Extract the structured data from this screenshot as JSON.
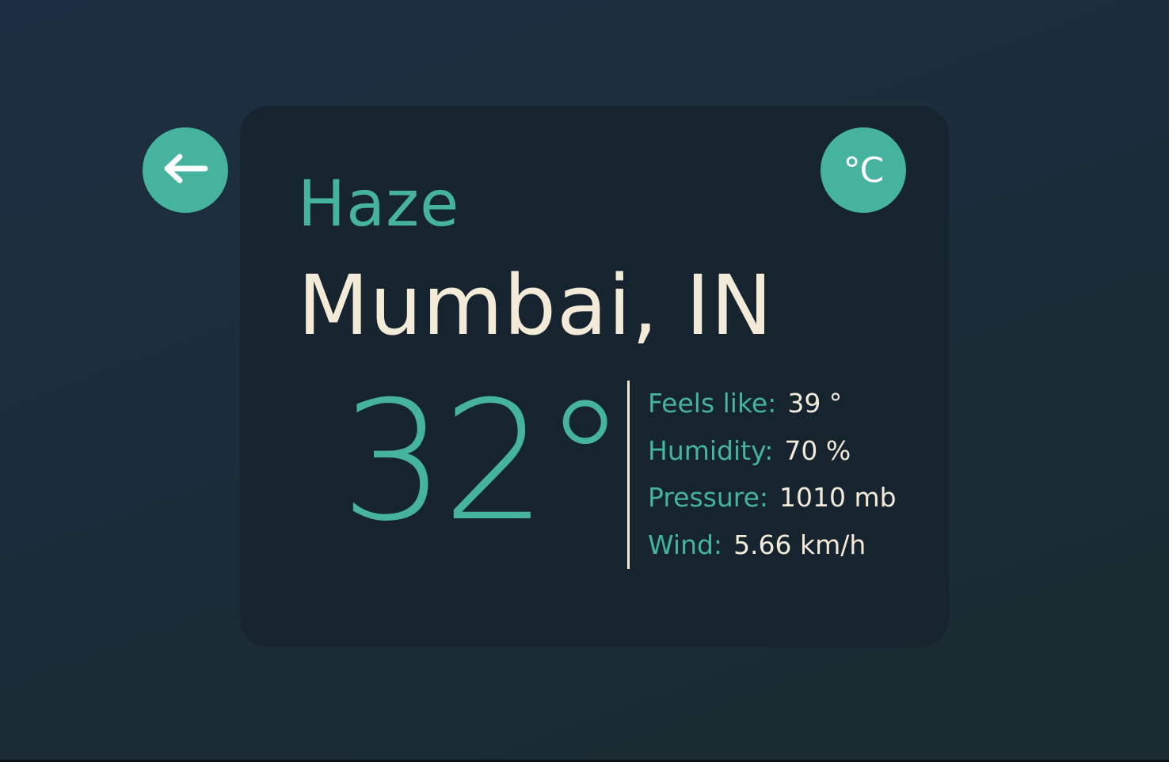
{
  "weather": {
    "condition": "Haze",
    "location": "Mumbai, IN",
    "temperature": "32°",
    "unit_toggle": "°C",
    "details": [
      {
        "label": "Feels like:",
        "value": "39 °"
      },
      {
        "label": "Humidity:",
        "value": "70 %"
      },
      {
        "label": "Pressure:",
        "value": "1010 mb"
      },
      {
        "label": "Wind:",
        "value": "5.66 km/h"
      }
    ]
  },
  "icons": {
    "back": "arrow-left-icon"
  },
  "colors": {
    "accent": "#45b39d",
    "text": "#f3ead8",
    "card": "#16242f",
    "background": "#1c2d3c"
  }
}
